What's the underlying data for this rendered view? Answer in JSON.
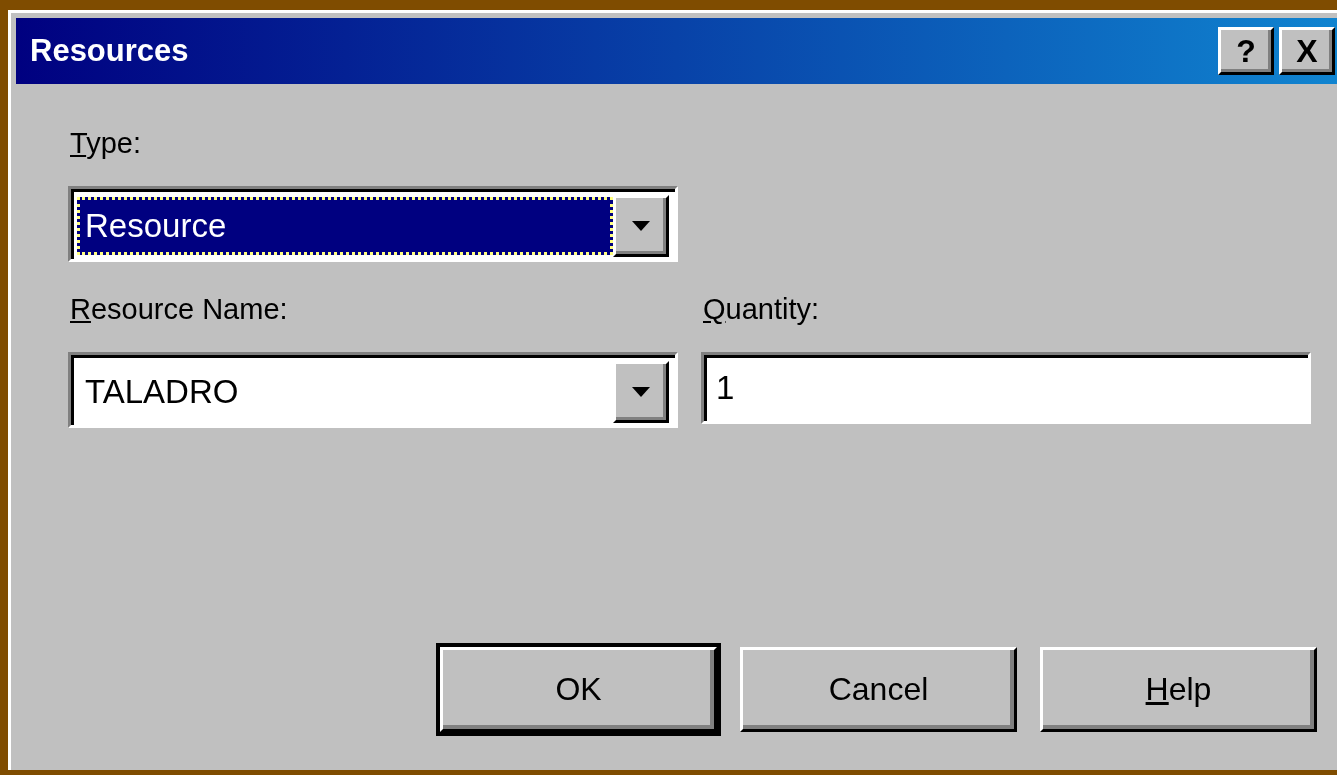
{
  "window": {
    "title": "Resources",
    "title_buttons": [
      "?",
      "X"
    ]
  },
  "field_rows": [
    [
      {
        "kind": "combo",
        "label": "Type:",
        "mnemonic": true,
        "value": "Resource",
        "focused": true
      }
    ],
    [
      {
        "kind": "combo",
        "label": "Resource Name:",
        "mnemonic": true,
        "value": "TALADRO",
        "focused": false
      },
      {
        "kind": "text",
        "label": "Quantity:",
        "mnemonic": true,
        "value": "1",
        "focused": false
      }
    ]
  ],
  "buttons": [
    {
      "label": "OK",
      "mnemonic": false,
      "default": true
    },
    {
      "label": "Cancel",
      "mnemonic": false,
      "default": false
    },
    {
      "label": "Help",
      "mnemonic": true,
      "default": false
    }
  ]
}
